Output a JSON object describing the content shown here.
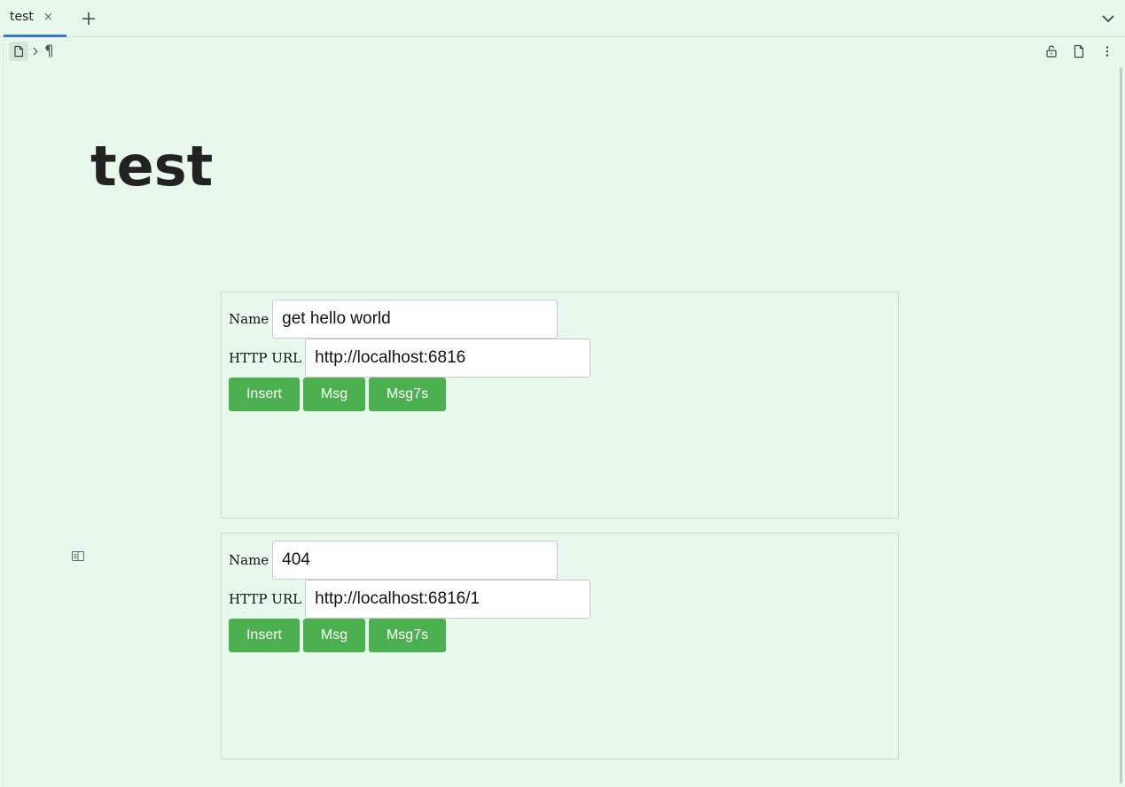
{
  "tabbar": {
    "tab_label": "test",
    "close_glyph": "×"
  },
  "breadcrumb": {
    "paragraph_glyph": "¶"
  },
  "document": {
    "title": "test"
  },
  "widgets": [
    {
      "name_label": "Name",
      "name_value": "get hello world",
      "url_label": "HTTP URL",
      "url_value": "http://localhost:6816",
      "buttons": [
        "Insert",
        "Msg",
        "Msg7s"
      ]
    },
    {
      "name_label": "Name",
      "name_value": "404",
      "url_label": "HTTP URL",
      "url_value": "http://localhost:6816/1",
      "buttons": [
        "Insert",
        "Msg",
        "Msg7s"
      ]
    }
  ],
  "colors": {
    "background": "#e8f8ec",
    "button": "#4caf50",
    "active_tab_underline": "#3575d6"
  },
  "icons": [
    "plus-icon",
    "chevron-down-icon",
    "document-icon",
    "chevron-right-icon",
    "unlock-icon",
    "file-icon",
    "more-vertical-icon",
    "block-embed-icon"
  ]
}
